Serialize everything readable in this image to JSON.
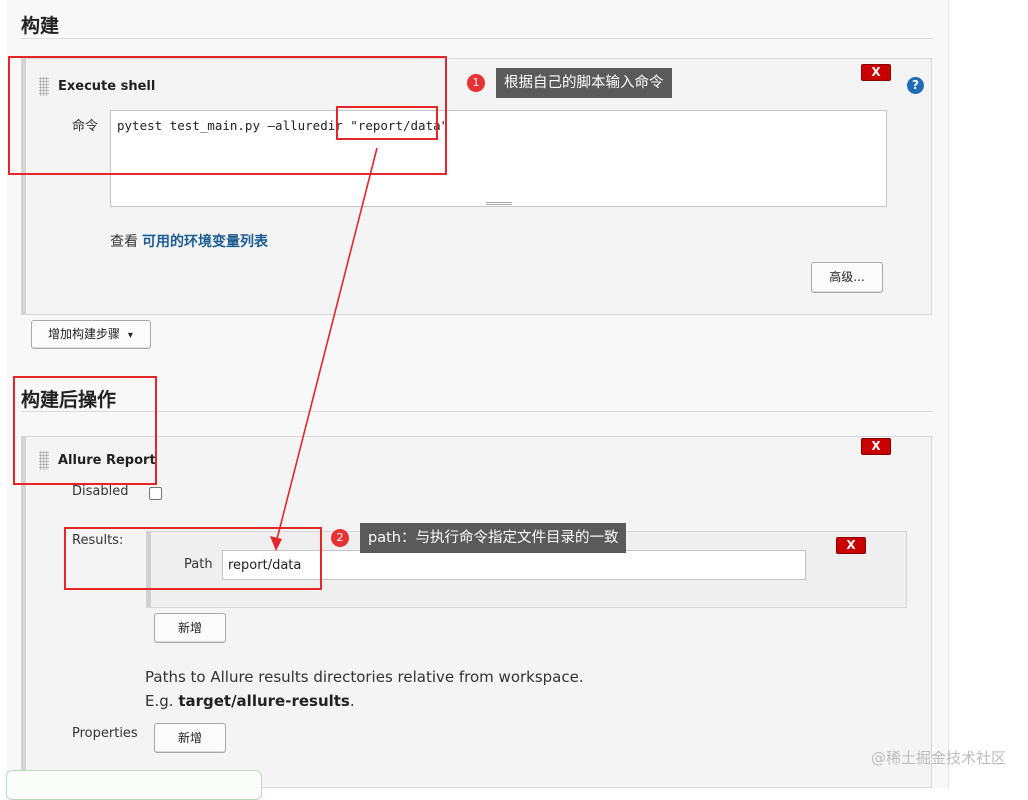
{
  "build_section": {
    "title": "构建",
    "step": {
      "title": "Execute shell",
      "command_label": "命令",
      "command_value": "pytest test_main.py —alluredir ",
      "command_arg": "\"report/data\"",
      "env_prefix": "查看",
      "env_link": "可用的环境变量列表",
      "advanced_button": "高级...",
      "delete_label": "X",
      "help_label": "?"
    },
    "add_step_button": "增加构建步骤",
    "add_step_caret": "▾"
  },
  "post_build_section": {
    "title": "构建后操作",
    "allure": {
      "title": "Allure Report",
      "delete_label": "X",
      "disabled_label": "Disabled",
      "disabled_checked": false,
      "results_label": "Results:",
      "path_label": "Path",
      "path_value": "report/data",
      "path_delete_label": "X",
      "add_results_button": "新增",
      "desc_line1": "Paths to Allure results directories relative from workspace.",
      "desc_prefix": "E.g. ",
      "desc_example": "target/allure-results",
      "desc_suffix": ".",
      "properties_label": "Properties",
      "add_properties_button": "新增"
    }
  },
  "annotations": [
    {
      "number": "1",
      "text": "根据自己的脚本输入命令"
    },
    {
      "number": "2",
      "text": "path：与执行命令指定文件目录的一致"
    }
  ],
  "watermark": "@稀土掘金技术社区",
  "colors": {
    "annotation_red": "#e2262a",
    "link_blue": "#1b5c93",
    "delete_red": "#c90000"
  }
}
